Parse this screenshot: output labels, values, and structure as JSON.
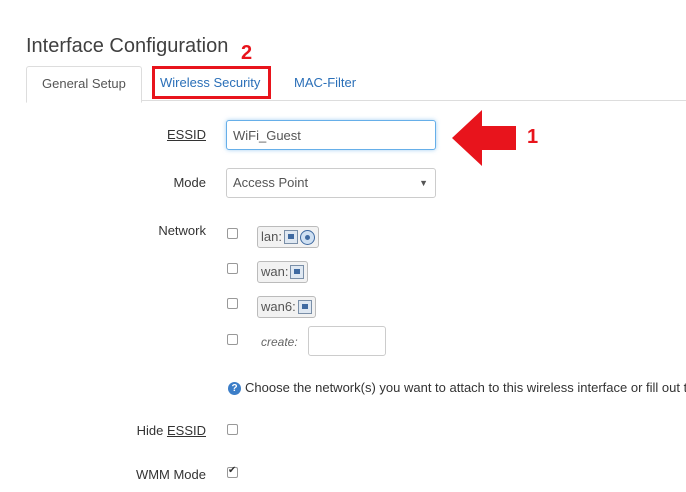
{
  "page": {
    "title": "Interface Configuration"
  },
  "tabs": [
    {
      "label": "General Setup",
      "active": true
    },
    {
      "label": "Wireless Security",
      "active": false
    },
    {
      "label": "MAC-Filter",
      "active": false
    }
  ],
  "annotations": {
    "num1": "1",
    "num2": "2",
    "color": "#e8141c"
  },
  "form": {
    "essid": {
      "label": "ESSID",
      "value": "WiFi_Guest"
    },
    "mode": {
      "label": "Mode",
      "value": "Access Point"
    },
    "network": {
      "label": "Network",
      "options": [
        {
          "name": "lan:",
          "icons": [
            "ethernet-icon",
            "wifi-icon"
          ],
          "checked": false
        },
        {
          "name": "wan:",
          "icons": [
            "ethernet-icon"
          ],
          "checked": false
        },
        {
          "name": "wan6:",
          "icons": [
            "ethernet-icon"
          ],
          "checked": false
        }
      ],
      "create_label": "create:",
      "help": "Choose the network(s) you want to attach to this wireless interface or fill out t"
    },
    "hide_essid": {
      "label_prefix": "Hide ",
      "label_u": "ESSID",
      "checked": false
    },
    "wmm_mode": {
      "label": "WMM Mode",
      "checked": true
    }
  }
}
